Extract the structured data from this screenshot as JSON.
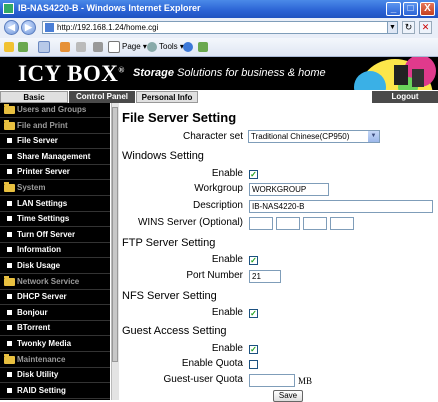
{
  "window": {
    "title": "IB-NAS4220-B - Windows Internet Explorer",
    "minimize": "_",
    "maximize": "□",
    "close": "X"
  },
  "browser": {
    "url": "http://192.168.1.24/home.cgi",
    "toolbar": {
      "page_label": "Page ▾",
      "tools_label": "Tools ▾"
    }
  },
  "header": {
    "logo": "ICY BOX",
    "logo_mark": "®",
    "tagline_bold": "Storage",
    "tagline_rest": " Solutions for business & home"
  },
  "menu": {
    "basic": "Basic",
    "control_panel": "Control Panel",
    "personal_info": "Personal Info",
    "logout": "Logout"
  },
  "sidebar": {
    "items": [
      {
        "label": "Users and Groups",
        "type": "group"
      },
      {
        "label": "File and Print",
        "type": "group"
      },
      {
        "label": "File Server",
        "type": "item"
      },
      {
        "label": "Share Management",
        "type": "item"
      },
      {
        "label": "Printer Server",
        "type": "item"
      },
      {
        "label": "System",
        "type": "group"
      },
      {
        "label": "LAN Settings",
        "type": "item"
      },
      {
        "label": "Time Settings",
        "type": "item"
      },
      {
        "label": "Turn Off Server",
        "type": "item"
      },
      {
        "label": "Information",
        "type": "item"
      },
      {
        "label": "Disk Usage",
        "type": "item"
      },
      {
        "label": "Network Service",
        "type": "group"
      },
      {
        "label": "DHCP Server",
        "type": "item"
      },
      {
        "label": "Bonjour",
        "type": "item"
      },
      {
        "label": "BTorrent",
        "type": "item"
      },
      {
        "label": "Twonky Media",
        "type": "item"
      },
      {
        "label": "Maintenance",
        "type": "group"
      },
      {
        "label": "Disk Utility",
        "type": "item"
      },
      {
        "label": "RAID Setting",
        "type": "item"
      }
    ]
  },
  "content": {
    "title": "File Server Setting",
    "charset_label": "Character set",
    "charset_value": "Traditional Chinese(CP950)",
    "windows": {
      "heading": "Windows Setting",
      "enable_label": "Enable",
      "workgroup_label": "Workgroup",
      "workgroup_value": "WORKGROUP",
      "description_label": "Description",
      "description_value": "IB-NAS4220-B",
      "wins_label": "WINS Server (Optional)"
    },
    "ftp": {
      "heading": "FTP Server Setting",
      "enable_label": "Enable",
      "port_label": "Port Number",
      "port_value": "21"
    },
    "nfs": {
      "heading": "NFS Server Setting",
      "enable_label": "Enable"
    },
    "guest": {
      "heading": "Guest Access Setting",
      "enable_label": "Enable",
      "quota_label": "Enable Quota",
      "user_quota_label": "Guest-user Quota",
      "unit": "MB",
      "save_label": "Save"
    },
    "check_mark": "✓"
  },
  "colors": {
    "sidebar_bg": "#000000",
    "header_bg": "#000000",
    "check": "#21a121",
    "titlebar": "#2a62d4"
  }
}
